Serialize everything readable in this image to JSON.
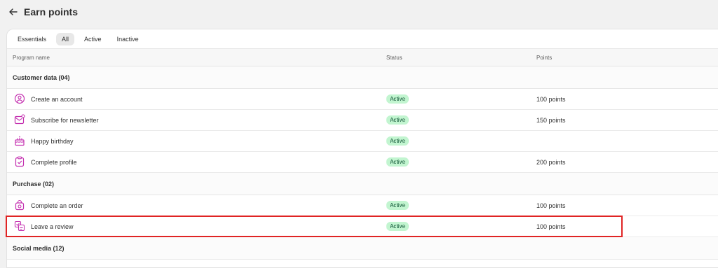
{
  "header": {
    "title": "Earn points"
  },
  "tabs": [
    "Essentials",
    "All",
    "Active",
    "Inactive"
  ],
  "columns": {
    "program": "Program name",
    "status": "Status",
    "points": "Points"
  },
  "groups": [
    {
      "label": "Customer data (04)",
      "rows": [
        {
          "name": "Create an account",
          "status": "Active",
          "points": "100 points",
          "icon": "user-circle-icon"
        },
        {
          "name": "Subscribe for newsletter",
          "status": "Active",
          "points": "150 points",
          "icon": "email-icon"
        },
        {
          "name": "Happy birthday",
          "status": "Active",
          "points": "",
          "icon": "cake-icon"
        },
        {
          "name": "Complete profile",
          "status": "Active",
          "points": "200 points",
          "icon": "clipboard-check-icon"
        }
      ]
    },
    {
      "label": "Purchase (02)",
      "rows": [
        {
          "name": "Complete an order",
          "status": "Active",
          "points": "100 points",
          "icon": "shopping-bag-icon"
        },
        {
          "name": "Leave a review",
          "status": "Active",
          "points": "100 points",
          "icon": "review-icon"
        }
      ]
    },
    {
      "label": "Social media (12)",
      "rows": []
    }
  ],
  "colors": {
    "accent": "#c430b0",
    "badge_bg": "#c2f5d0",
    "badge_text": "#0c5132",
    "highlight": "#e02424"
  }
}
